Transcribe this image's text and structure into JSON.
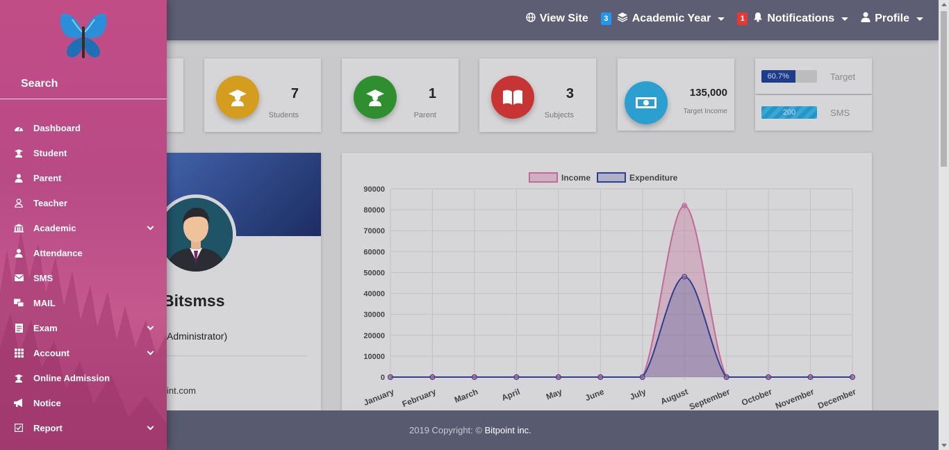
{
  "topnav": {
    "view_site": "View Site",
    "academic_badge": "3",
    "academic_year": "Academic Year",
    "notifications_badge": "1",
    "notifications": "Notifications",
    "profile": "Profile"
  },
  "stats": [
    {
      "value": "7",
      "label": "Students",
      "color": "#d59d1e"
    },
    {
      "value": "1",
      "label": "Parent",
      "color": "#2f8f2f"
    },
    {
      "value": "3",
      "label": "Subjects",
      "color": "#c73434"
    },
    {
      "value": "135,000",
      "label": "Target Income",
      "color": "#2a9fd0"
    }
  ],
  "progress": [
    {
      "text": "60.7%",
      "label": "Target",
      "percent": 60.7
    },
    {
      "text": "200",
      "label": "SMS",
      "percent": 100
    }
  ],
  "profile": {
    "name": "Bitsmss",
    "role": "Administrator)",
    "email": "int.com"
  },
  "chart_data": {
    "type": "area",
    "categories": [
      "January",
      "February",
      "March",
      "April",
      "May",
      "June",
      "July",
      "August",
      "September",
      "October",
      "November",
      "December"
    ],
    "series": [
      {
        "name": "Income",
        "values": [
          0,
          0,
          0,
          0,
          0,
          0,
          0,
          82000,
          0,
          0,
          0,
          0
        ],
        "color": "#c06a96"
      },
      {
        "name": "Expenditure",
        "values": [
          0,
          0,
          0,
          0,
          0,
          0,
          0,
          48000,
          0,
          0,
          0,
          0
        ],
        "color": "#2f3f8f"
      }
    ],
    "yticks": [
      0,
      10000,
      20000,
      30000,
      40000,
      50000,
      60000,
      70000,
      80000,
      90000
    ],
    "ylim": [
      0,
      90000
    ],
    "legend": "top",
    "grid": true
  },
  "footer": {
    "text": "2019 Copyright: © ",
    "company": "Bitpoint inc."
  },
  "sidebar": {
    "search": "Search",
    "items": [
      {
        "label": "Dashboard",
        "icon": "dashboard-icon",
        "submenu": false
      },
      {
        "label": "Student",
        "icon": "student-icon",
        "submenu": false
      },
      {
        "label": "Parent",
        "icon": "parent-icon",
        "submenu": false
      },
      {
        "label": "Teacher",
        "icon": "teacher-icon",
        "submenu": false
      },
      {
        "label": "Academic",
        "icon": "academic-icon",
        "submenu": true
      },
      {
        "label": "Attendance",
        "icon": "attendance-icon",
        "submenu": false
      },
      {
        "label": "SMS",
        "icon": "sms-icon",
        "submenu": false
      },
      {
        "label": "MAIL",
        "icon": "mail-icon",
        "submenu": false
      },
      {
        "label": "Exam",
        "icon": "exam-icon",
        "submenu": true
      },
      {
        "label": "Account",
        "icon": "account-icon",
        "submenu": true
      },
      {
        "label": "Online Admission",
        "icon": "admission-icon",
        "submenu": false
      },
      {
        "label": "Notice",
        "icon": "notice-icon",
        "submenu": false
      },
      {
        "label": "Report",
        "icon": "report-icon",
        "submenu": true
      }
    ]
  }
}
